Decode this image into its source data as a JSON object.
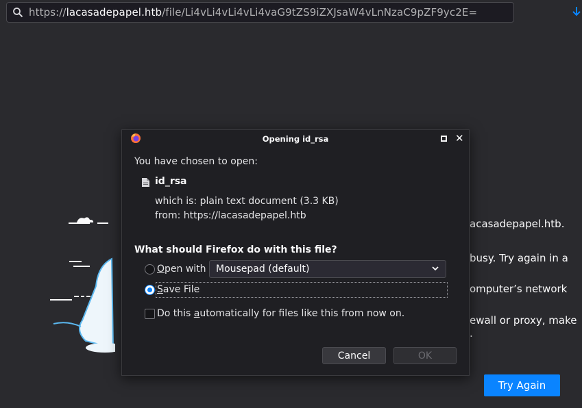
{
  "browser": {
    "url_scheme": "https://",
    "url_host": "lacasadepapel.htb",
    "url_path": "/file/Li4vLi4vLi4vLi4vaG9tZS9iZXJsaW4vLnNzaC9pZF9yc2E=",
    "search_icon": "search-icon",
    "download_icon": "download-arrow-icon"
  },
  "error_page": {
    "line1": "acasadepapel.htb.",
    "line2": "busy. Try again in a",
    "line3": "omputer’s network",
    "line4": "ewall or proxy, make",
    "line5": ".",
    "try_again_label": "Try Again"
  },
  "dialog": {
    "title": "Opening id_rsa",
    "intro": "You have chosen to open:",
    "file_name": "id_rsa",
    "which_is_label": "which is:",
    "which_is_value": "plain text document (3.3 KB)",
    "from_label": "from:",
    "from_value": "https://lacasadepapel.htb",
    "question": "What should Firefox do with this file?",
    "open_with_label": "pen with",
    "open_with_accesskey": "O",
    "open_with_app": "Mousepad (default)",
    "save_file_accesskey": "S",
    "save_file_label": "ave File",
    "auto_label_pre": "Do this ",
    "auto_label_key": "a",
    "auto_label_post": "utomatically for files like this from now on.",
    "cancel_label": "Cancel",
    "ok_label": "OK",
    "selected_option": "save_file"
  },
  "colors": {
    "accent": "#0a84ff",
    "page_bg": "#2a2a2e",
    "dialog_bg": "#1f1f23"
  }
}
